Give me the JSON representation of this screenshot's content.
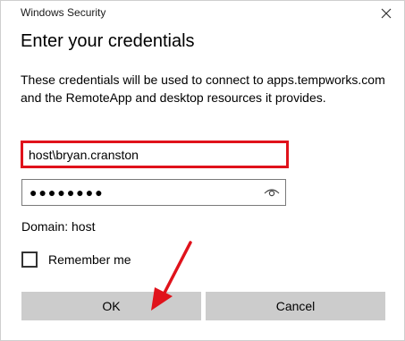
{
  "window": {
    "title": "Windows Security",
    "close_icon": "close-icon"
  },
  "dialog": {
    "heading": "Enter your credentials",
    "description": "These credentials will be used to connect to apps.tempworks.com and the RemoteApp and desktop resources it provides."
  },
  "username": {
    "value": "host\\bryan.cranston",
    "highlight_color": "#e0121b"
  },
  "password": {
    "masked_value": "●●●●●●●●",
    "reveal_icon": "eye-icon"
  },
  "domain_label": "Domain: host",
  "remember_me": {
    "label": "Remember me",
    "checked": false
  },
  "buttons": {
    "ok_label": "OK",
    "cancel_label": "Cancel"
  },
  "annotation": {
    "arrow_color": "#e0121b"
  }
}
